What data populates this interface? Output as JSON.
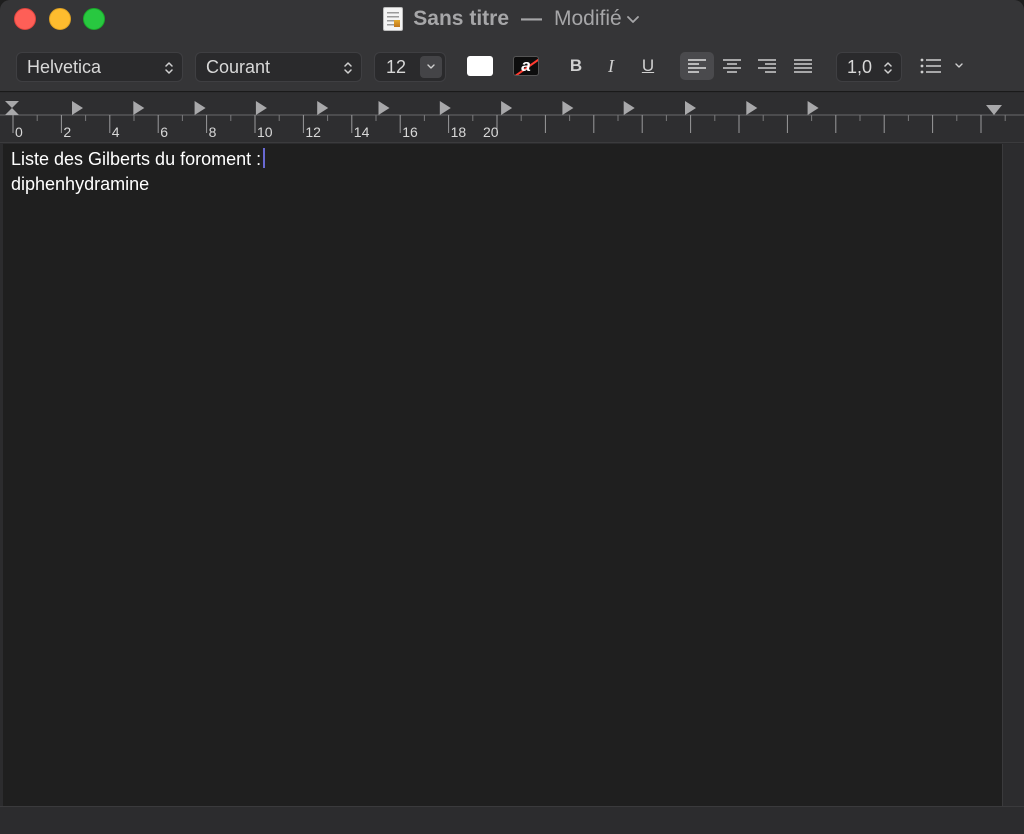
{
  "window": {
    "title": "Sans titre",
    "separator": "—",
    "status": "Modifié"
  },
  "toolbar": {
    "font_family": "Helvetica",
    "font_style": "Courant",
    "font_size": "12",
    "text_color": "#ffffff",
    "background_color_glyph": "a",
    "bold_label": "B",
    "italic_label": "I",
    "underline_label": "U",
    "alignment_active": "left",
    "line_spacing": "1,0"
  },
  "ruler": {
    "labels": [
      "0",
      "2",
      "4",
      "6",
      "8",
      "10",
      "12",
      "14",
      "16",
      "18",
      "20"
    ]
  },
  "document": {
    "lines": [
      "Liste des Gilberts du foroment :",
      "diphenhydramine"
    ]
  }
}
